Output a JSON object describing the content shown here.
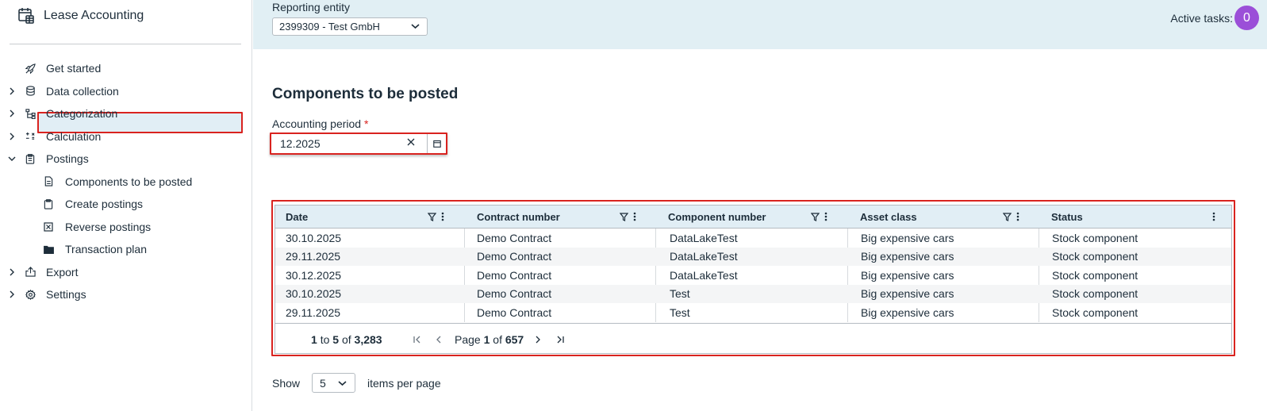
{
  "app": {
    "title": "Lease Accounting"
  },
  "sidebar": {
    "items": [
      {
        "label": "Get started",
        "icon": "rocket-icon",
        "expandable": false
      },
      {
        "label": "Data collection",
        "icon": "database-icon",
        "expandable": true
      },
      {
        "label": "Categorization",
        "icon": "hierarchy-icon",
        "expandable": true
      },
      {
        "label": "Calculation",
        "icon": "calculator-icon",
        "expandable": true
      },
      {
        "label": "Postings",
        "icon": "clipboard-icon",
        "expandable": true,
        "expanded": true
      }
    ],
    "postings_children": [
      {
        "label": "Components to be posted",
        "icon": "document-icon",
        "active": true
      },
      {
        "label": "Create postings",
        "icon": "clipboard-icon"
      },
      {
        "label": "Reverse postings",
        "icon": "cancel-box-icon"
      },
      {
        "label": "Transaction plan",
        "icon": "folder-icon"
      }
    ],
    "bottom_items": [
      {
        "label": "Export",
        "icon": "export-icon",
        "expandable": true
      },
      {
        "label": "Settings",
        "icon": "gear-icon",
        "expandable": true
      }
    ]
  },
  "header": {
    "entity_label": "Reporting entity",
    "entity_value": "2399309 - Test GmbH",
    "tasks_label": "Active tasks:",
    "tasks_count": "0"
  },
  "main": {
    "title": "Components to be posted",
    "period_label": "Accounting period",
    "period_required_mark": "*",
    "period_value": "12.2025"
  },
  "grid": {
    "columns": [
      {
        "label": "Date",
        "filter": true
      },
      {
        "label": "Contract number",
        "filter": true
      },
      {
        "label": "Component number",
        "filter": true
      },
      {
        "label": "Asset class",
        "filter": true
      },
      {
        "label": "Status",
        "filter": false
      }
    ],
    "rows": [
      [
        "30.10.2025",
        "Demo Contract",
        "DataLakeTest",
        "Big expensive cars",
        "Stock component"
      ],
      [
        "29.11.2025",
        "Demo Contract",
        "DataLakeTest",
        "Big expensive cars",
        "Stock component"
      ],
      [
        "30.12.2025",
        "Demo Contract",
        "DataLakeTest",
        "Big expensive cars",
        "Stock component"
      ],
      [
        "30.10.2025",
        "Demo Contract",
        "Test",
        "Big expensive cars",
        "Stock component"
      ],
      [
        "29.11.2025",
        "Demo Contract",
        "Test",
        "Big expensive cars",
        "Stock component"
      ]
    ],
    "footer": {
      "range_from": "1",
      "range_to_word": "to",
      "range_to": "5",
      "of_word": "of",
      "total": "3,283",
      "page_word": "Page",
      "page": "1",
      "pages_of_word": "of",
      "page_count": "657"
    }
  },
  "pager": {
    "show_label": "Show",
    "page_size": "5",
    "per_page_label": "items per page"
  },
  "colors": {
    "accent_badge": "#9b4fd8",
    "highlight_red": "#d9231f",
    "header_bg": "#e1eff4"
  }
}
